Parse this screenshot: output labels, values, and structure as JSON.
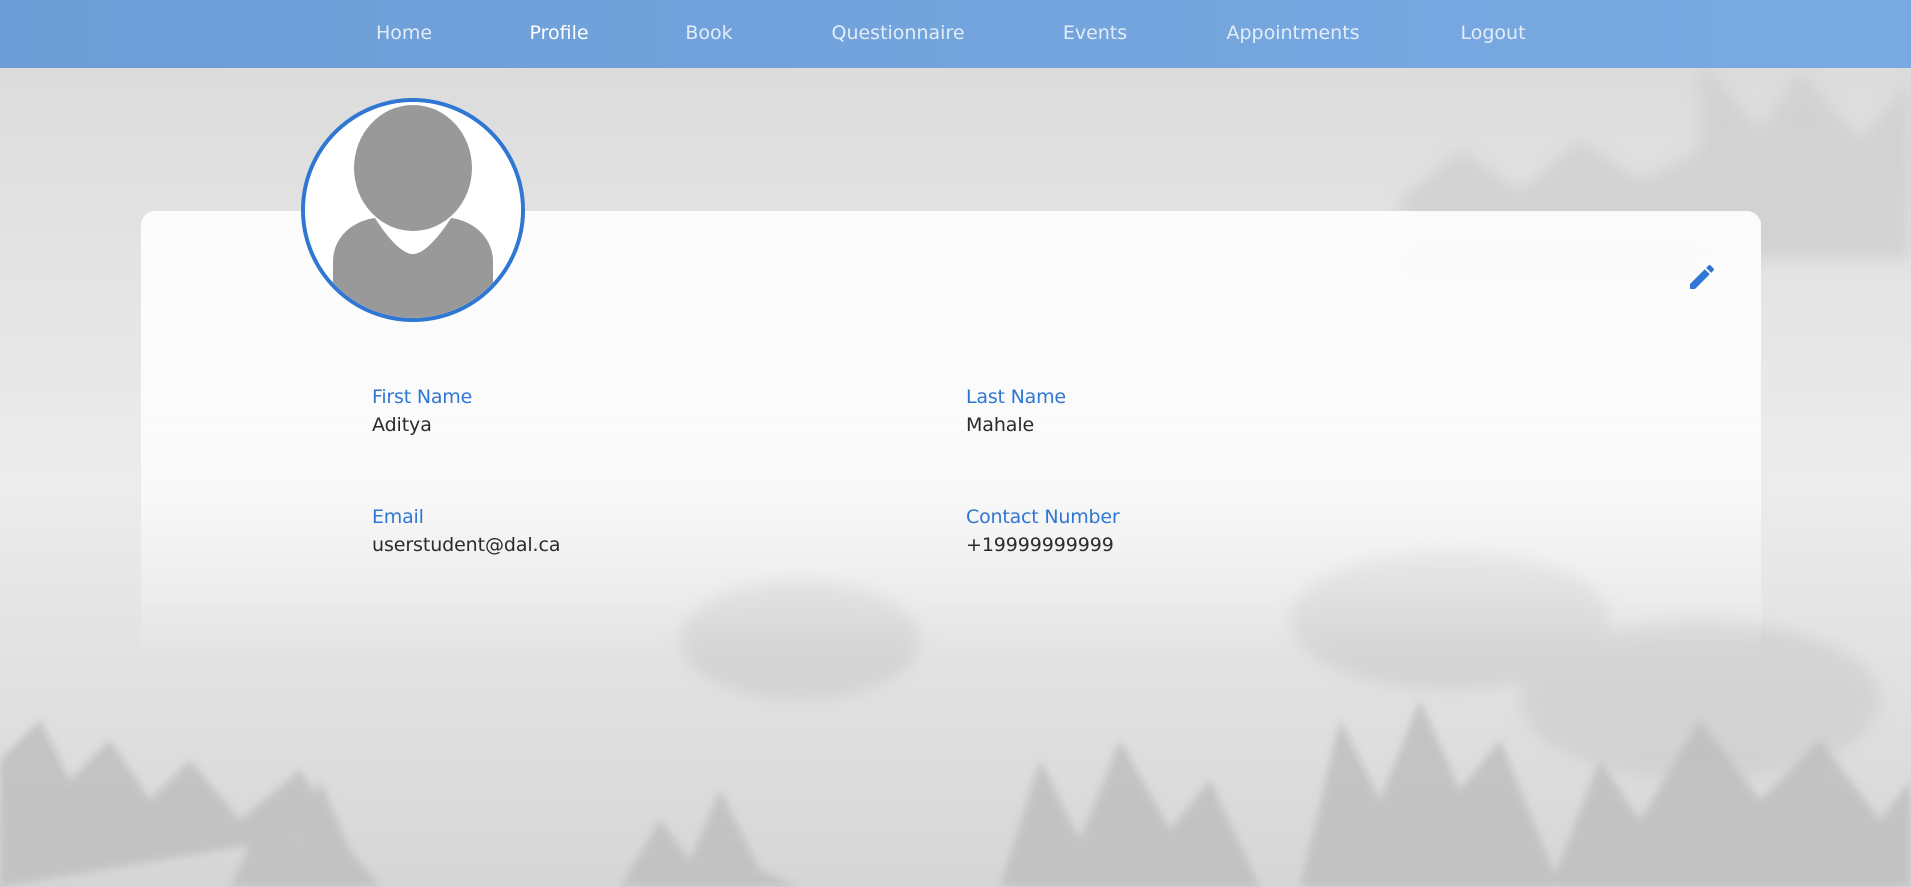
{
  "nav": {
    "items": [
      {
        "label": "Home"
      },
      {
        "label": "Profile"
      },
      {
        "label": "Book"
      },
      {
        "label": "Questionnaire"
      },
      {
        "label": "Events"
      },
      {
        "label": "Appointments"
      },
      {
        "label": "Logout"
      }
    ],
    "active_item": "Profile"
  },
  "profile": {
    "avatar_icon": "default-user-avatar",
    "edit_icon": "pencil-icon",
    "fields": [
      {
        "label": "First Name",
        "value": "Aditya"
      },
      {
        "label": "Last Name",
        "value": "Mahale"
      },
      {
        "label": "Email",
        "value": "userstudent@dal.ca"
      },
      {
        "label": "Contact Number",
        "value": "+19999999999"
      }
    ]
  },
  "colors": {
    "navbar": "#72a3dc",
    "accent": "#2f77d3",
    "nav_text": "#e3edf8",
    "nav_text_active": "#ffffff",
    "value_text": "#2a2a2a",
    "avatar_fill": "#999999"
  }
}
